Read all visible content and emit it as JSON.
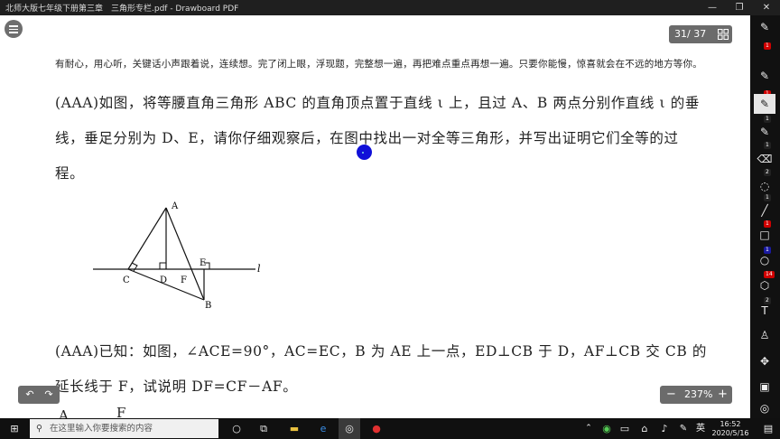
{
  "window": {
    "title": "北师大版七年级下册第三章　三角形专栏.pdf - Drawboard PDF",
    "minimize": "—",
    "restore": "❐",
    "close": "✕"
  },
  "viewer": {
    "page_indicator": "31/ 37",
    "zoom_level": "237%",
    "zoom_out": "−",
    "zoom_in": "+",
    "undo": "↶",
    "redo": "↷"
  },
  "document": {
    "note": "有耐心，用心听，关键话小声跟着说，连续想。完了闭上眼，浮现题，完整想一遍，再把难点重点再想一遍。只要你能慢，惊喜就会在不远的地方等你。",
    "problem1": "(AAA)如图，将等腰直角三角形 ABC 的直角顶点置于直线 ι 上，且过 A、B 两点分别作直线 ι 的垂线，垂足分别为 D、E，请你仔细观察后，在图中找出一对全等三角形，并写出证明它们全等的过程。",
    "figure_labels": {
      "A": "A",
      "B": "B",
      "C": "C",
      "D": "D",
      "E": "E",
      "F": "F",
      "l": "l"
    },
    "problem2": "(AAA)已知：如图，∠ACE=90°，AC=EC，B 为 AE 上一点，ED⊥CB 于 D，AF⊥CB 交 CB 的延长线于 F，试说明 DF=CF－AF。",
    "next_fig_A": "A",
    "next_fig_F": "F"
  },
  "toolbar": {
    "badges": [
      "1",
      "1",
      "1",
      "1",
      "2",
      "1",
      "1",
      "1",
      "14",
      "2"
    ],
    "badge_colors": [
      "#d00000",
      "#d00000",
      "#222222",
      "#222222",
      "#222222",
      "#d00000",
      "#1a1aa0",
      "#d00000",
      "#222222",
      "#00a000"
    ]
  },
  "taskbar": {
    "search_placeholder": "在这里输入你要搜索的内容",
    "ime": "英",
    "time": "16:52",
    "date": "2020/5/16"
  }
}
